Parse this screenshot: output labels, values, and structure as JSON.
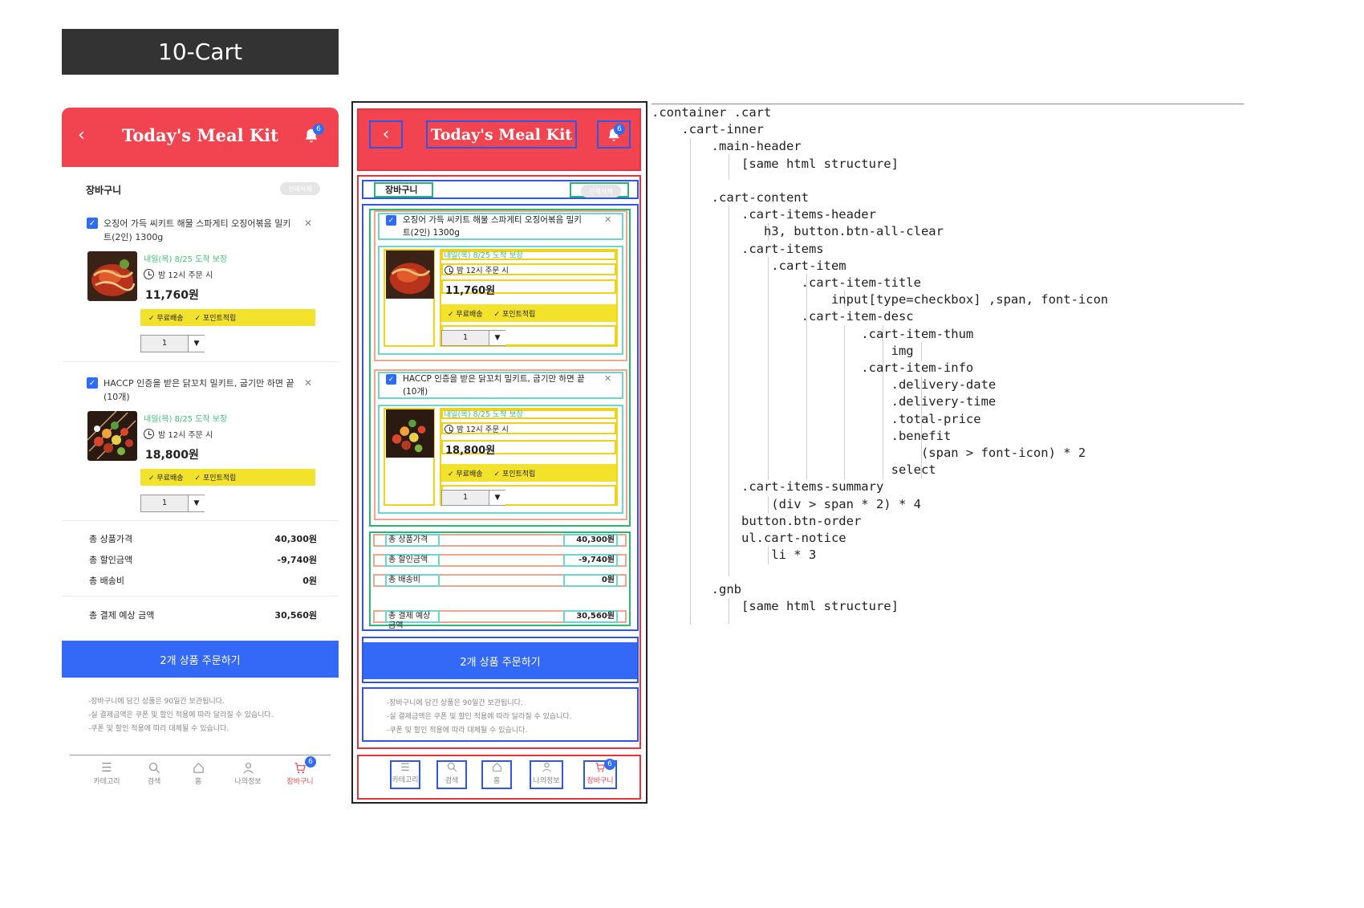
{
  "page_title": "10-Cart",
  "app": {
    "header_title": "Today's Meal Kit",
    "back_icon": "chevron-left-icon",
    "bell_icon": "bell-icon",
    "bell_badge": "6"
  },
  "cart": {
    "heading": "장바구니",
    "clear_all": "전체삭제",
    "items": [
      {
        "name": "오징어 가득 씨키트 해물 스파게티 오징어볶음 밀키트(2인) 1300g",
        "delivery_date": "내일(목) 8/25 도착 보장",
        "delivery_time": "밤 12시 주문 시",
        "price": "11,760원",
        "benefits": [
          "무료배송",
          "포인트적립"
        ],
        "quantity": "1"
      },
      {
        "name": "HACCP 인증을 받은 닭꼬치 밀키트, 굽기만 하면 끝(10개)",
        "delivery_date": "내일(목) 8/25 도착 보장",
        "delivery_time": "밤 12시 주문 시",
        "price": "18,800원",
        "benefits": [
          "무료배송",
          "포인트적립"
        ],
        "quantity": "1"
      }
    ],
    "summary": [
      {
        "label": "총 상품가격",
        "value": "40,300원"
      },
      {
        "label": "총 할인금액",
        "value": "-9,740원"
      },
      {
        "label": "총 배송비",
        "value": "0원"
      },
      {
        "label": "총 결제 예상 금액",
        "value": "30,560원"
      }
    ],
    "order_button": "2개 상품 주문하기",
    "notices": [
      "-장바구니에 담긴 상품은 90일간 보관됩니다.",
      "-실 결제금액은 쿠폰 및 할인 적용에 따라 달라질 수 있습니다.",
      "-쿠폰 및 할인 적용에 따라 대체될 수 있습니다."
    ]
  },
  "gnb": [
    {
      "label": "카테고리",
      "icon": "menu-icon"
    },
    {
      "label": "검색",
      "icon": "search-icon"
    },
    {
      "label": "홈",
      "icon": "home-icon"
    },
    {
      "label": "나의정보",
      "icon": "user-icon"
    },
    {
      "label": "장바구니",
      "icon": "cart-icon",
      "badge": "6",
      "active": true
    }
  ],
  "colors": {
    "header": "#f24450",
    "order_button": "#3369f6",
    "benefit": "#f3e22b",
    "delivery_date": "#3dc37a"
  },
  "code_lines": [
    ".container .cart",
    "    .cart-inner",
    "        .main-header",
    "            [same html structure]",
    "",
    "        .cart-content",
    "            .cart-items-header",
    "               h3, button.btn-all-clear",
    "            .cart-items",
    "                .cart-item",
    "                    .cart-item-title",
    "                        input[type=checkbox] ,span, font-icon",
    "                    .cart-item-desc",
    "                            .cart-item-thum",
    "                                img",
    "                            .cart-item-info",
    "                                .delivery-date",
    "                                .delivery-time",
    "                                .total-price",
    "                                .benefit",
    "                                    (span > font-icon) * 2",
    "                                select",
    "            .cart-items-summary",
    "                (div > span * 2) * 4",
    "            button.btn-order",
    "            ul.cart-notice",
    "                li * 3",
    "",
    "        .gnb",
    "            [same html structure]"
  ]
}
